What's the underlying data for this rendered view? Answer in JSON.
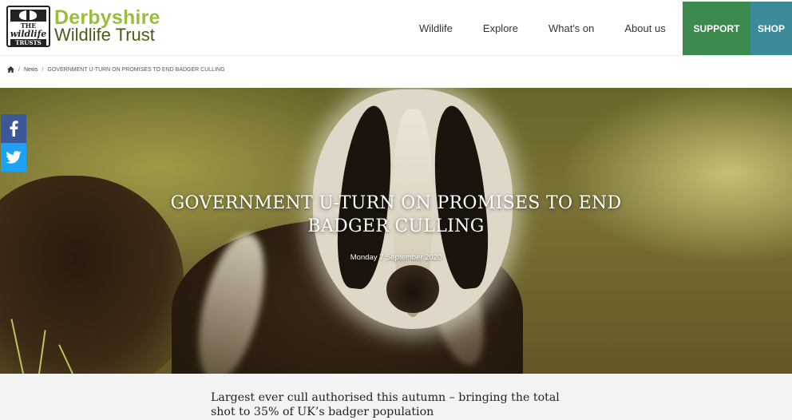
{
  "header": {
    "logo": {
      "name_line1": "Derbyshire",
      "name_line2": "Wildlife Trust",
      "badge_line1": "THE",
      "badge_line2": "wildlife",
      "badge_line3": "TRUSTS"
    },
    "nav": [
      {
        "label": "Wildlife"
      },
      {
        "label": "Explore"
      },
      {
        "label": "What's on"
      },
      {
        "label": "About us"
      }
    ],
    "support_label": "SUPPORT",
    "shop_label": "SHOP"
  },
  "breadcrumb": {
    "items": [
      "News"
    ],
    "current": "GOVERNMENT U-TURN ON PROMISES TO END BADGER CULLING"
  },
  "hero": {
    "title_line1": "GOVERNMENT U-TURN ON PROMISES TO END",
    "title_line2": "BADGER CULLING",
    "date": "Monday 7 September 2020"
  },
  "share": {
    "facebook_icon": "facebook-icon",
    "twitter_icon": "twitter-icon"
  },
  "intro": {
    "line1": "Largest ever cull authorised this autumn – bringing the total",
    "line2": "shot to 35% of UK’s badger population"
  },
  "colors": {
    "brand_green": "#97bf3d",
    "support_bg": "#3d8a4e",
    "shop_bg": "#3c8a9a",
    "facebook": "#3b5998",
    "twitter": "#1da1f2"
  }
}
